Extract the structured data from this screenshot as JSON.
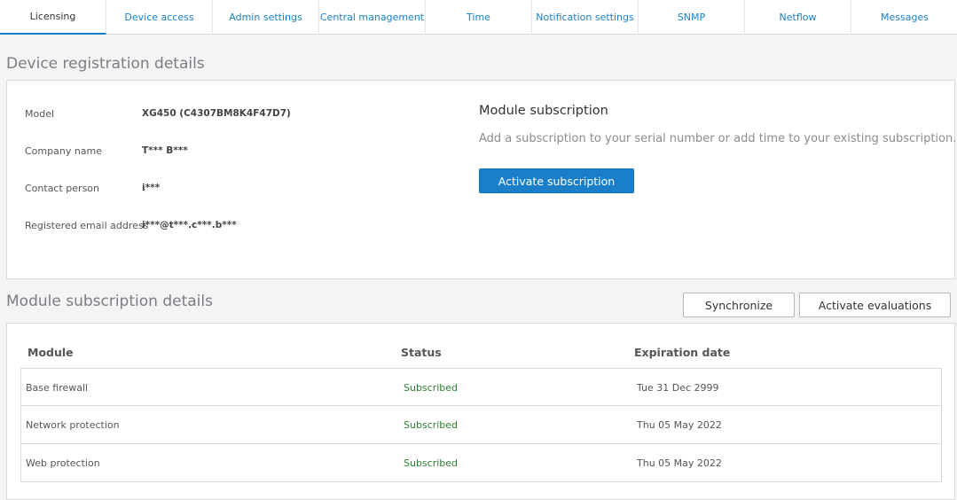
{
  "tabs": [
    {
      "label": "Licensing",
      "active": true
    },
    {
      "label": "Device access"
    },
    {
      "label": "Admin settings"
    },
    {
      "label": "Central management"
    },
    {
      "label": "Time"
    },
    {
      "label": "Notification settings"
    },
    {
      "label": "SNMP"
    },
    {
      "label": "Netflow"
    },
    {
      "label": "Messages"
    }
  ],
  "registration": {
    "title": "Device registration details",
    "fields": [
      {
        "label": "Model",
        "value": "XG450 (C4307BM8K4F47D7)"
      },
      {
        "label": "Company name",
        "value": "T*** B***"
      },
      {
        "label": "Contact person",
        "value": "i***"
      },
      {
        "label": "Registered email address",
        "value": "i***@t***.c***.b***"
      }
    ],
    "module_subscription": {
      "title": "Module subscription",
      "description": "Add a subscription to your serial number or add time to your existing subscription.",
      "activate_label": "Activate subscription"
    }
  },
  "subscriptions": {
    "title": "Module subscription details",
    "synchronize_label": "Synchronize",
    "activate_evaluations_label": "Activate evaluations",
    "columns": [
      "Module",
      "Status",
      "Expiration date"
    ],
    "rows": [
      {
        "module": "Base firewall",
        "status": "Subscribed",
        "expiration": "Tue 31 Dec 2999"
      },
      {
        "module": "Network protection",
        "status": "Subscribed",
        "expiration": "Thu 05 May 2022"
      },
      {
        "module": "Web protection",
        "status": "Subscribed",
        "expiration": "Thu 05 May 2022"
      }
    ]
  },
  "colors": {
    "accent": "#1a7fc8",
    "status_ok": "#2e7d32"
  }
}
